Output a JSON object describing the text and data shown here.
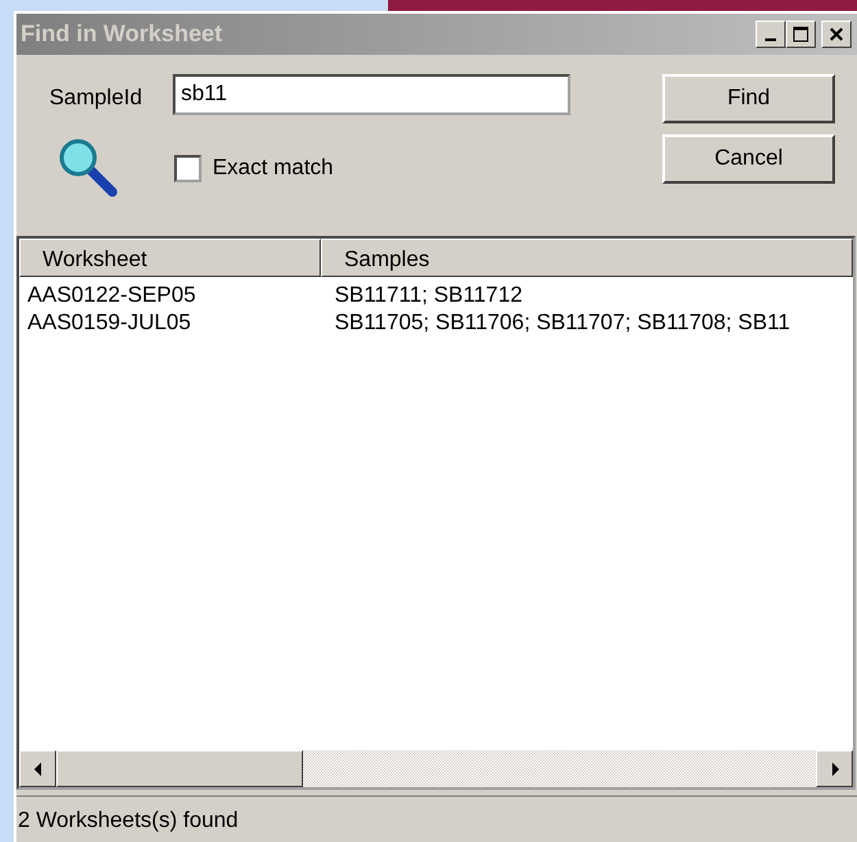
{
  "window": {
    "title": "Find in Worksheet"
  },
  "search": {
    "label": "SampleId",
    "value": "sb11"
  },
  "exact_match": {
    "label": "Exact match",
    "checked": false
  },
  "buttons": [
    "Find",
    "Cancel"
  ],
  "table": {
    "columns": [
      "Worksheet",
      "Samples"
    ],
    "rows": [
      [
        "AAS0122-SEP05",
        "SB11711; SB11712"
      ],
      [
        "AAS0159-JUL05",
        "SB11705; SB11706; SB11707; SB11708; SB11"
      ]
    ]
  },
  "status_bar": "2 Worksheets(s) found"
}
